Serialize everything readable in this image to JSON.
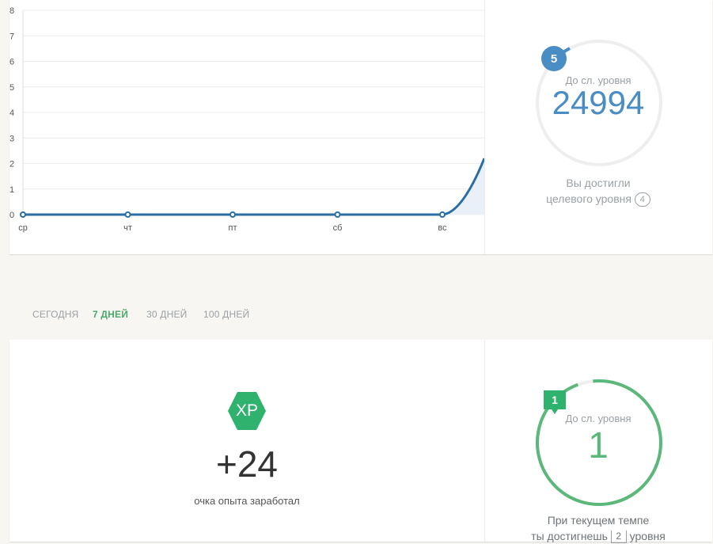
{
  "chart": {
    "chart_data": {
      "type": "line",
      "categories": [
        "ср",
        "чт",
        "пт",
        "сб",
        "вс"
      ],
      "series": [
        {
          "values": [
            0,
            0,
            0,
            0,
            0,
            2.2
          ]
        }
      ],
      "ylim": [
        0,
        8
      ],
      "yticks": [
        "0",
        "1",
        "2",
        "3",
        "4",
        "5",
        "6",
        "7",
        "8"
      ],
      "grid": true,
      "color": "#2a6ea6",
      "area_fill": "#e9f0f8"
    }
  },
  "level_top": {
    "badge": "5",
    "caption": "До сл. уровня",
    "value": "24994",
    "goal_line1": "Вы достигли",
    "goal_line2": "целевого уровня",
    "goal_level": "4",
    "accent": "#4a8cc4"
  },
  "tabs": [
    {
      "label": "СЕГОДНЯ",
      "active": false
    },
    {
      "label": "7 ДНЕЙ",
      "active": true
    },
    {
      "label": "30 ДНЕЙ",
      "active": false
    },
    {
      "label": "100 ДНЕЙ",
      "active": false
    }
  ],
  "xp": {
    "badge": "XP",
    "value": "+24",
    "caption": "очка опыта заработал",
    "color": "#2fb26d"
  },
  "level_bottom": {
    "badge": "1",
    "caption": "До сл. уровня",
    "value": "1",
    "pace_line1": "При текущем темпе",
    "pace_line2_pre": "ты достигнешь",
    "pace_level": "2",
    "pace_line2_post": "уровня",
    "accent": "#5cb87a",
    "progress": 0.96
  }
}
